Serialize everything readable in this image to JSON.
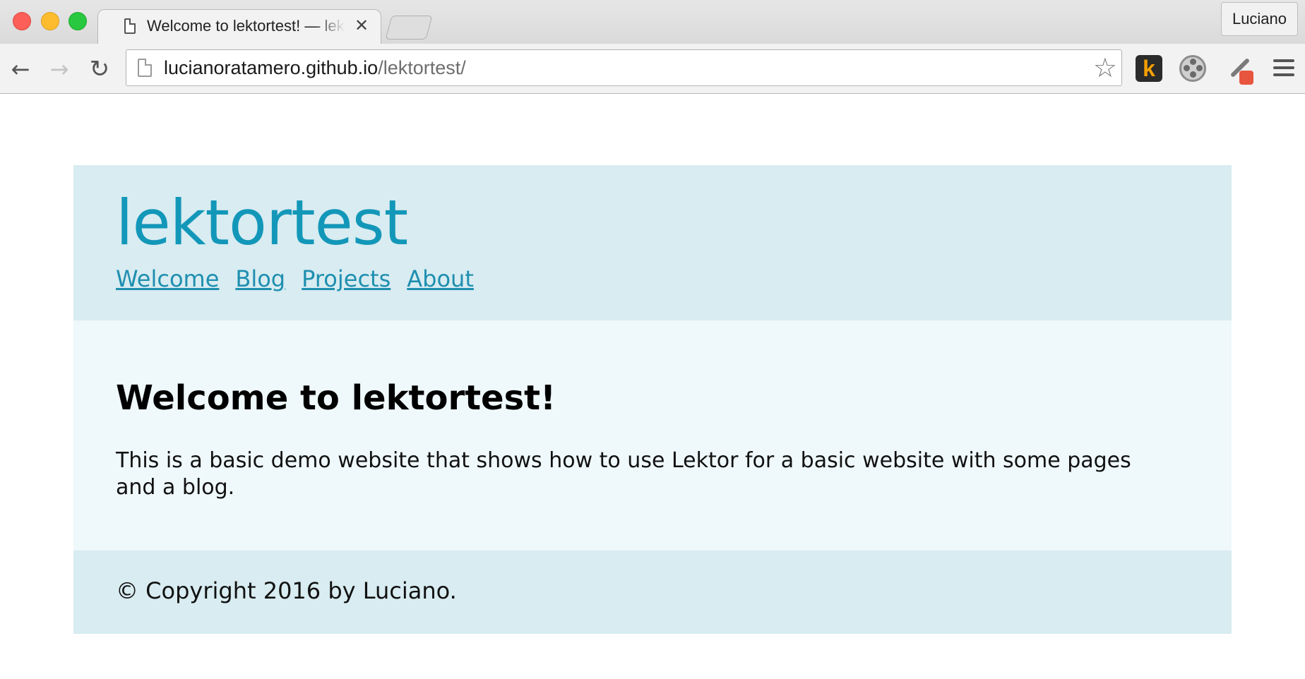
{
  "browser": {
    "tab": {
      "title": "Welcome to lektortest! — lektortest",
      "close_glyph": "✕"
    },
    "profile_name": "Luciano",
    "nav": {
      "back": "←",
      "forward": "→",
      "reload": "↻"
    },
    "address": {
      "host": "lucianoratamero.github.io",
      "path": "/lektortest/"
    },
    "star_glyph": "☆",
    "extensions": [
      {
        "icon": "k-extension-icon",
        "label": "k"
      },
      {
        "icon": "film-reel-icon"
      },
      {
        "icon": "eyedropper-icon"
      }
    ]
  },
  "site": {
    "title": "lektortest",
    "nav": [
      {
        "label": "Welcome"
      },
      {
        "label": "Blog"
      },
      {
        "label": "Projects"
      },
      {
        "label": "About"
      }
    ],
    "main": {
      "heading": "Welcome to lektortest!",
      "body": "This is a basic demo website that shows how to use Lektor for a basic website with some pages and a blog."
    },
    "footer": "© Copyright 2016 by Luciano.",
    "colors": {
      "header_bg": "#d8ecf1",
      "main_bg": "#eff8fa",
      "title": "#1397b9",
      "link": "#1f8fb0"
    }
  }
}
